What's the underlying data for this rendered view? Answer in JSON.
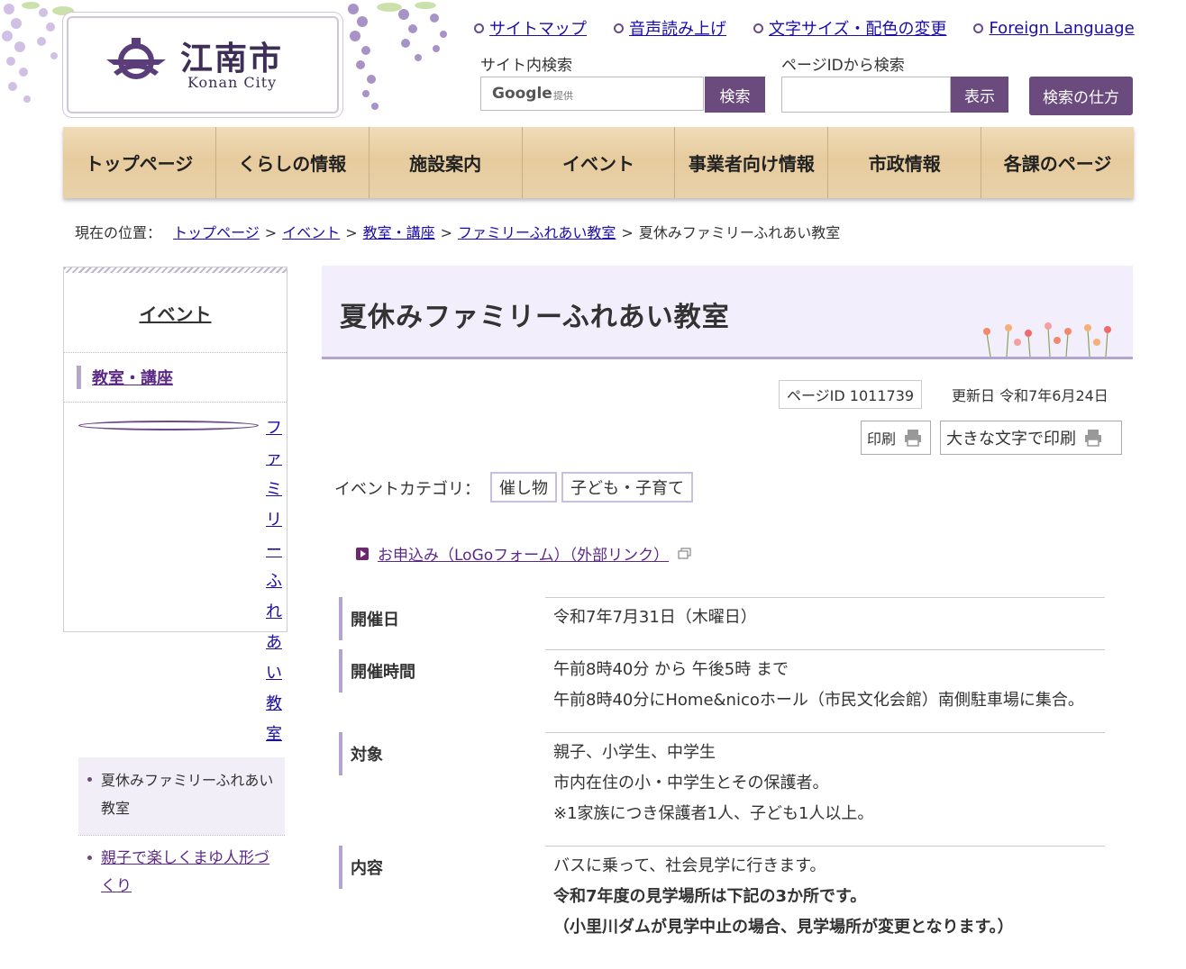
{
  "header": {
    "logo_title": "江南市",
    "logo_sub": "Konan City",
    "util_links": [
      "サイトマップ",
      "音声読み上げ",
      "文字サイズ・配色の変更",
      "Foreign Language"
    ],
    "site_search_label": "サイト内検索",
    "google_mark": "Google",
    "google_sub": "提供",
    "search_button": "検索",
    "pageid_label": "ページIDから検索",
    "show_button": "表示",
    "howto_button": "検索の仕方"
  },
  "nav": [
    "トップページ",
    "くらしの情報",
    "施設案内",
    "イベント",
    "事業者向け情報",
    "市政情報",
    "各課のページ"
  ],
  "breadcrumb": {
    "prefix": "現在の位置：",
    "links": [
      "トップページ",
      "イベント",
      "教室・講座",
      "ファミリーふれあい教室"
    ],
    "current": "夏休みファミリーふれあい教室",
    "sep": ">"
  },
  "sidebar": {
    "heading": "イベント",
    "category": "教室・講座",
    "sub": "ファミリーふれあい教室",
    "current": "夏休みファミリーふれあい教室",
    "other": "親子で楽しくまゆ人形づくり"
  },
  "main": {
    "title": "夏休みファミリーふれあい教室",
    "page_id": "ページID 1011739",
    "updated": "更新日 令和7年6月24日",
    "print": "印刷",
    "print_large": "大きな文字で印刷",
    "category_label": "イベントカテゴリ：",
    "categories": [
      "催し物",
      "子ども・子育て"
    ],
    "apply_link": "お申込み（LoGoフォーム）（外部リンク）",
    "info": [
      {
        "label": "開催日",
        "values": [
          "令和7年7月31日（木曜日）"
        ]
      },
      {
        "label": "開催時間",
        "values": [
          "午前8時40分 から 午後5時 まで",
          "午前8時40分にHome&nicoホール（市民文化会館）南側駐車場に集合。"
        ]
      },
      {
        "label": "対象",
        "values": [
          "親子、小学生、中学生",
          "市内在住の小・中学生とその保護者。",
          "※1家族につき保護者1人、子ども1人以上。"
        ]
      },
      {
        "label": "内容",
        "values": [
          "バスに乗って、社会見学に行きます。",
          "令和7年度の見学場所は下記の3か所です。",
          "（小里川ダムが見学中止の場合、見学場所が変更となります。）"
        ]
      }
    ]
  },
  "colors": {
    "accent": "#6b4a7e",
    "nav_wood": "#e6cb9d",
    "title_band": "#f3eefb"
  }
}
